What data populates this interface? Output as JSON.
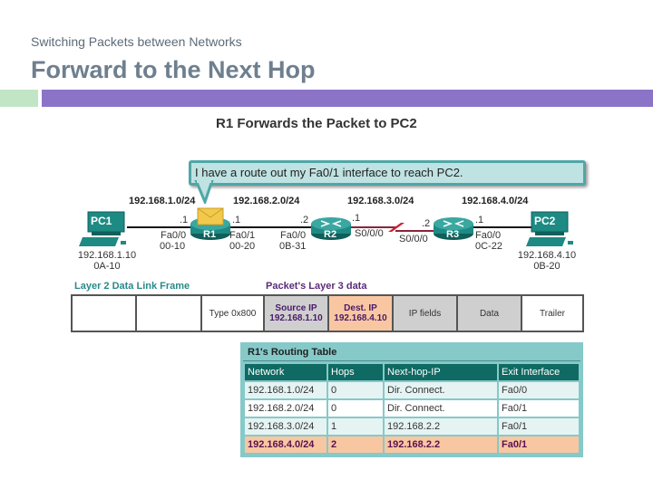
{
  "header": {
    "subtitle": "Switching Packets between Networks",
    "title": "Forward to the Next Hop"
  },
  "colors": {
    "accent_green": "#c2e5c6",
    "accent_purple": "#8b74c8",
    "device_teal": "#1e8a84",
    "table_header": "#0e6a62",
    "highlight_row": "#f8c7a2",
    "serial_link": "#8a2438"
  },
  "diagram": {
    "title": "R1 Forwards the Packet to PC2",
    "callout": "I have a route out my Fa0/1 interface to reach PC2.",
    "networks": [
      "192.168.1.0/24",
      "192.168.2.0/24",
      "192.168.3.0/24",
      "192.168.4.0/24"
    ],
    "devices": {
      "pc1": {
        "label": "PC1",
        "ip": "192.168.1.10",
        "mac": "0A-10"
      },
      "pc2": {
        "label": "PC2",
        "ip": "192.168.4.10",
        "mac": "0B-20"
      },
      "r1": {
        "label": "R1",
        "packet_icon": "envelope-icon"
      },
      "r2": {
        "label": "R2"
      },
      "r3": {
        "label": "R3"
      }
    },
    "interfaces": {
      "r1_fa00": {
        "host": ".1",
        "name": "Fa0/0",
        "mac": "00-10"
      },
      "r1_fa01": {
        "host": ".1",
        "name": "Fa0/1",
        "mac": "00-20"
      },
      "r2_fa00": {
        "host": ".2",
        "name": "Fa0/0",
        "mac": "0B-31"
      },
      "r2_s000": {
        "host": ".1",
        "name": "S0/0/0"
      },
      "r3_s000": {
        "host": ".2",
        "name": "S0/0/0"
      },
      "r3_fa00": {
        "host": ".1",
        "name": "Fa0/0",
        "mac": "0C-22"
      }
    }
  },
  "frame": {
    "layer2_label": "Layer 2 Data Link Frame",
    "layer3_label": "Packet's Layer 3 data",
    "cells": [
      {
        "text": ""
      },
      {
        "text": ""
      },
      {
        "text": "Type 0x800"
      },
      {
        "heading": "Source IP",
        "value": "192.168.1.10"
      },
      {
        "heading": "Dest. IP",
        "value": "192.168.4.10"
      },
      {
        "text": "IP fields"
      },
      {
        "text": "Data"
      },
      {
        "text": "Trailer"
      }
    ]
  },
  "routing_table": {
    "title": "R1's Routing Table",
    "columns": [
      "Network",
      "Hops",
      "Next-hop-IP",
      "Exit Interface"
    ],
    "rows": [
      [
        "192.168.1.0/24",
        "0",
        "Dir. Connect.",
        "Fa0/0"
      ],
      [
        "192.168.2.0/24",
        "0",
        "Dir. Connect.",
        "Fa0/1"
      ],
      [
        "192.168.3.0/24",
        "1",
        "192.168.2.2",
        "Fa0/1"
      ],
      [
        "192.168.4.0/24",
        "2",
        "192.168.2.2",
        "Fa0/1"
      ]
    ],
    "highlighted_row": 3
  }
}
